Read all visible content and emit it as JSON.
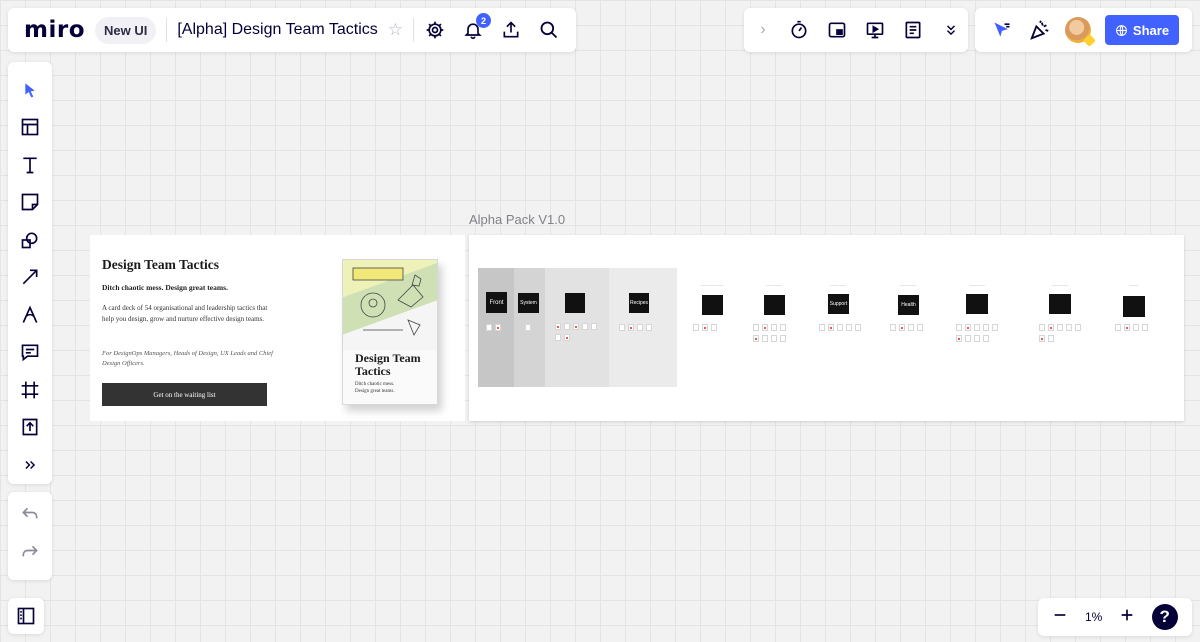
{
  "topbar": {
    "logo": "miro",
    "new_ui_label": "New UI",
    "board_title": "[Alpha] Design Team Tactics",
    "notifications_count": "2",
    "share_label": "Share"
  },
  "zoom": {
    "level": "1%",
    "help": "?"
  },
  "canvas": {
    "frame_label": "Alpha Pack V1.0",
    "landing": {
      "title": "Design Team Tactics",
      "subtitle": "Ditch chaotic mess. Design great teams.",
      "description": "A card deck of 54 organisational and leadership tactics that help you design, grow and nurture effective design teams.",
      "audience": "For DesignOps Managers, Heads of Design, UX Leads and Chief Design Officers.",
      "cta": "Get on the waiting list",
      "box_title": "Design Team Tactics",
      "box_subtitle": "Ditch chaotic mess. Design great teams."
    },
    "deck_cards": [
      "Front",
      "System",
      "Recipes",
      "Support",
      "Health"
    ]
  },
  "colors": {
    "accent": "#4262ff",
    "ink": "#050038"
  }
}
